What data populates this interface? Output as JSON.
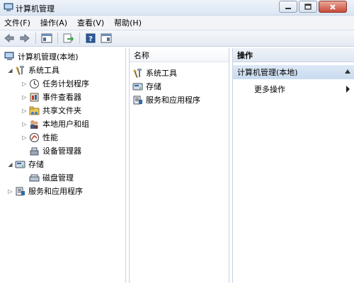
{
  "window": {
    "title": "计算机管理"
  },
  "menubar": {
    "items": [
      "文件(F)",
      "操作(A)",
      "查看(V)",
      "帮助(H)"
    ]
  },
  "tree": {
    "root": "计算机管理(本地)",
    "system_tools": "系统工具",
    "task_scheduler": "任务计划程序",
    "event_viewer": "事件查看器",
    "shared_folders": "共享文件夹",
    "local_users": "本地用户和组",
    "performance": "性能",
    "device_manager": "设备管理器",
    "storage": "存储",
    "disk_management": "磁盘管理",
    "services_apps": "服务和应用程序"
  },
  "middle": {
    "column_header": "名称",
    "items": [
      "系统工具",
      "存储",
      "服务和应用程序"
    ]
  },
  "actions": {
    "header": "操作",
    "group": "计算机管理(本地)",
    "more": "更多操作"
  }
}
